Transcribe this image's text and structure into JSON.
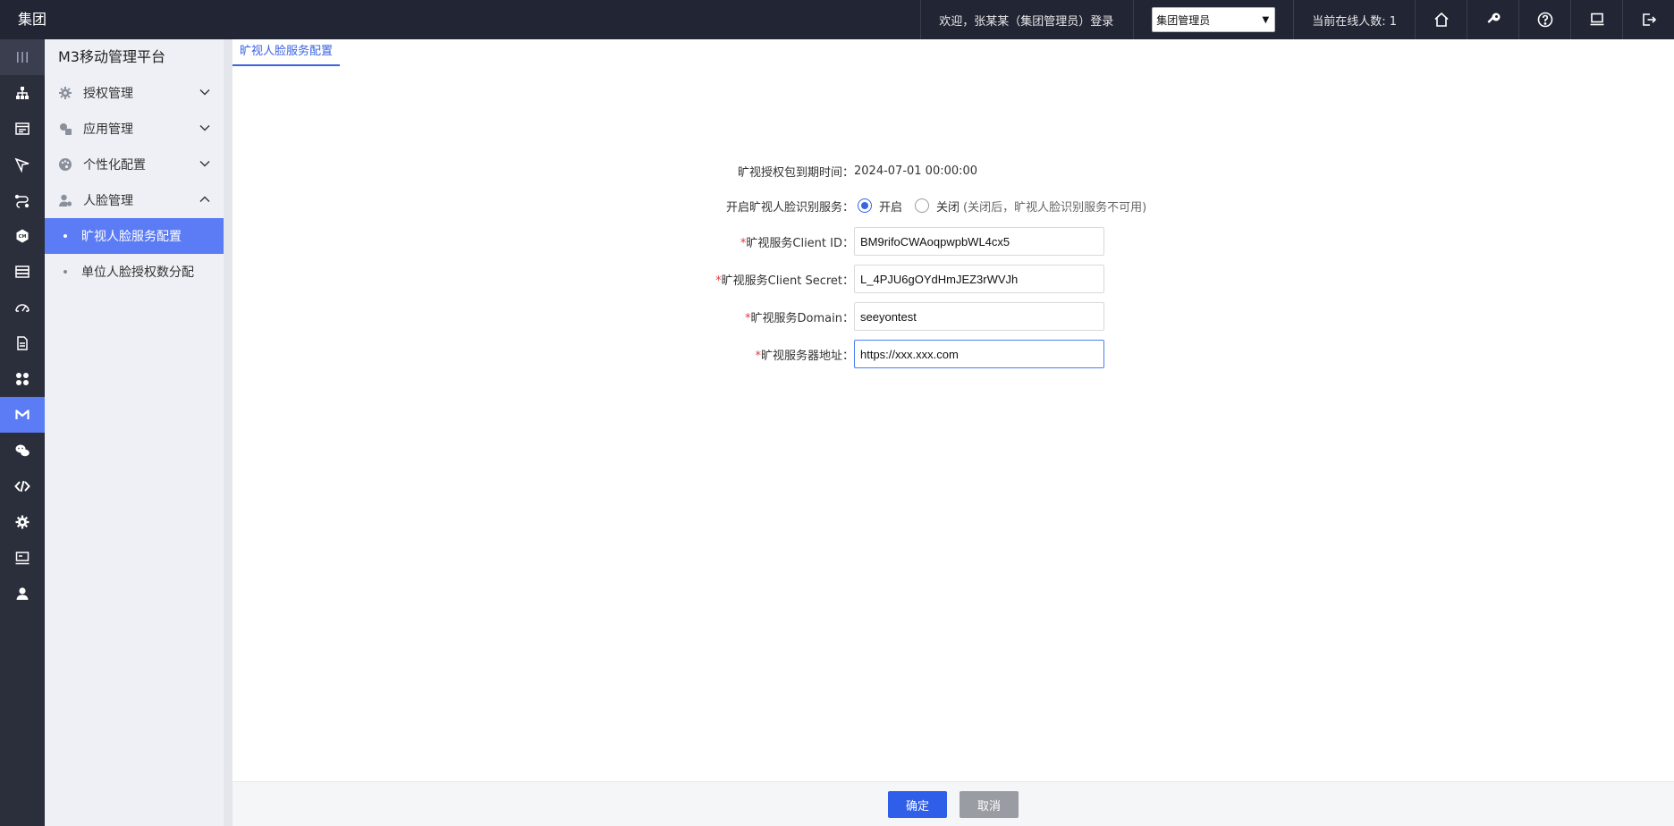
{
  "header": {
    "brand": "集团",
    "welcome": "欢迎，张某某（集团管理员）登录",
    "role_selected": "集团管理员",
    "online_text": "当前在线人数: 1",
    "icons": [
      "home-icon",
      "key-icon",
      "help-icon",
      "monitor-icon",
      "logout-icon"
    ]
  },
  "rail": {
    "icons": [
      "org-icon",
      "form-icon",
      "workflow-icon",
      "integration-icon",
      "cm-icon",
      "database-icon",
      "speed-icon",
      "document-icon",
      "apps-icon",
      "m3-icon",
      "wechat-icon",
      "code-icon",
      "settings-icon",
      "screen-icon",
      "user-icon"
    ],
    "active_index": 9,
    "active_color": "#5b7cf5"
  },
  "sidebar": {
    "title": "M3移动管理平台",
    "groups": [
      {
        "label": "授权管理",
        "icon": "gear-icon",
        "expanded": false
      },
      {
        "label": "应用管理",
        "icon": "app-icon",
        "expanded": false
      },
      {
        "label": "个性化配置",
        "icon": "palette-icon",
        "expanded": false
      },
      {
        "label": "人脸管理",
        "icon": "face-user-icon",
        "expanded": true
      }
    ],
    "sub_items": [
      {
        "label": "旷视人脸服务配置",
        "active": true
      },
      {
        "label": "单位人脸授权数分配",
        "active": false
      }
    ]
  },
  "tab": {
    "label": "旷视人脸服务配置"
  },
  "form": {
    "expire_label": "旷视授权包到期时间：",
    "expire_value": "2024-07-01 00:00:00",
    "enable_label": "开启旷视人脸识别服务：",
    "radio_on": "开启",
    "radio_off": "关闭",
    "radio_hint": "(关闭后，旷视人脸识别服务不可用)",
    "radio_selected": "开启",
    "required_mark": "*",
    "client_id_label": "旷视服务Client ID：",
    "client_id_value": "BM9rifoCWAoqpwpbWL4cx5",
    "client_secret_label": "旷视服务Client Secret：",
    "client_secret_value": "L_4PJU6gOYdHmJEZ3rWVJh",
    "domain_label": "旷视服务Domain：",
    "domain_value": "seeyontest",
    "server_label": "旷视服务器地址：",
    "server_value": "https://xxx.xxx.com"
  },
  "footer": {
    "ok_label": "确定",
    "cancel_label": "取消"
  },
  "colors": {
    "topbar": "#222533",
    "accent": "#2f5ee8",
    "required": "#e63a3a"
  }
}
